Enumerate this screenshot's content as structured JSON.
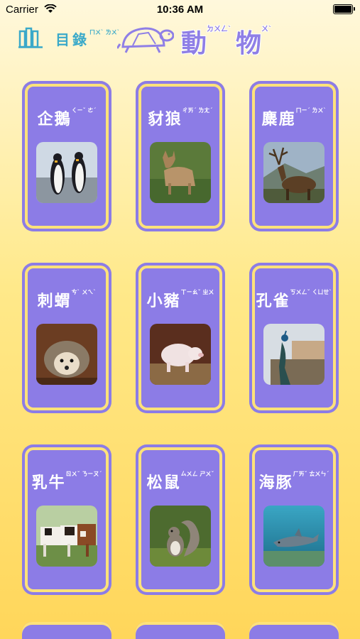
{
  "status": {
    "carrier": "Carrier",
    "time": "10:36 AM"
  },
  "header": {
    "catalog": "目錄",
    "catalog_zhuyin": "ㄇㄨˋ ㄌㄨˋ",
    "title_char1": "動",
    "title_zy1": "ㄉㄨㄥˋ",
    "title_char2": "物",
    "title_zy2": "ㄨˋ"
  },
  "animals": [
    {
      "name": "企鵝",
      "zhuyin": "ㄑㄧˇ ㄜˊ",
      "photo": "penguin"
    },
    {
      "name": "豺狼",
      "zhuyin": "ㄔㄞˊ ㄌㄤˊ",
      "photo": "jackal"
    },
    {
      "name": "麋鹿",
      "zhuyin": "ㄇㄧˊ ㄌㄨˋ",
      "photo": "elk"
    },
    {
      "name": "刺蝟",
      "zhuyin": "ㄘˋ ㄨㄟˋ",
      "photo": "hedgehog"
    },
    {
      "name": "小豬",
      "zhuyin": "ㄒㄧㄠˇ ㄓㄨ",
      "photo": "piglet"
    },
    {
      "name": "孔雀",
      "zhuyin": "ㄎㄨㄥˇ ㄑㄩㄝˋ",
      "photo": "peacock"
    },
    {
      "name": "乳牛",
      "zhuyin": "ㄖㄨˇ ㄋㄧㄡˊ",
      "photo": "cow"
    },
    {
      "name": "松鼠",
      "zhuyin": "ㄙㄨㄥ ㄕㄨˇ",
      "photo": "squirrel"
    },
    {
      "name": "海豚",
      "zhuyin": "ㄏㄞˇ ㄊㄨㄣˊ",
      "photo": "dolphin"
    }
  ],
  "colors": {
    "card": "#8c7ce6",
    "card_border": "#ffe27a",
    "catalog": "#3aa9c9",
    "title": "#8f7fe6"
  }
}
